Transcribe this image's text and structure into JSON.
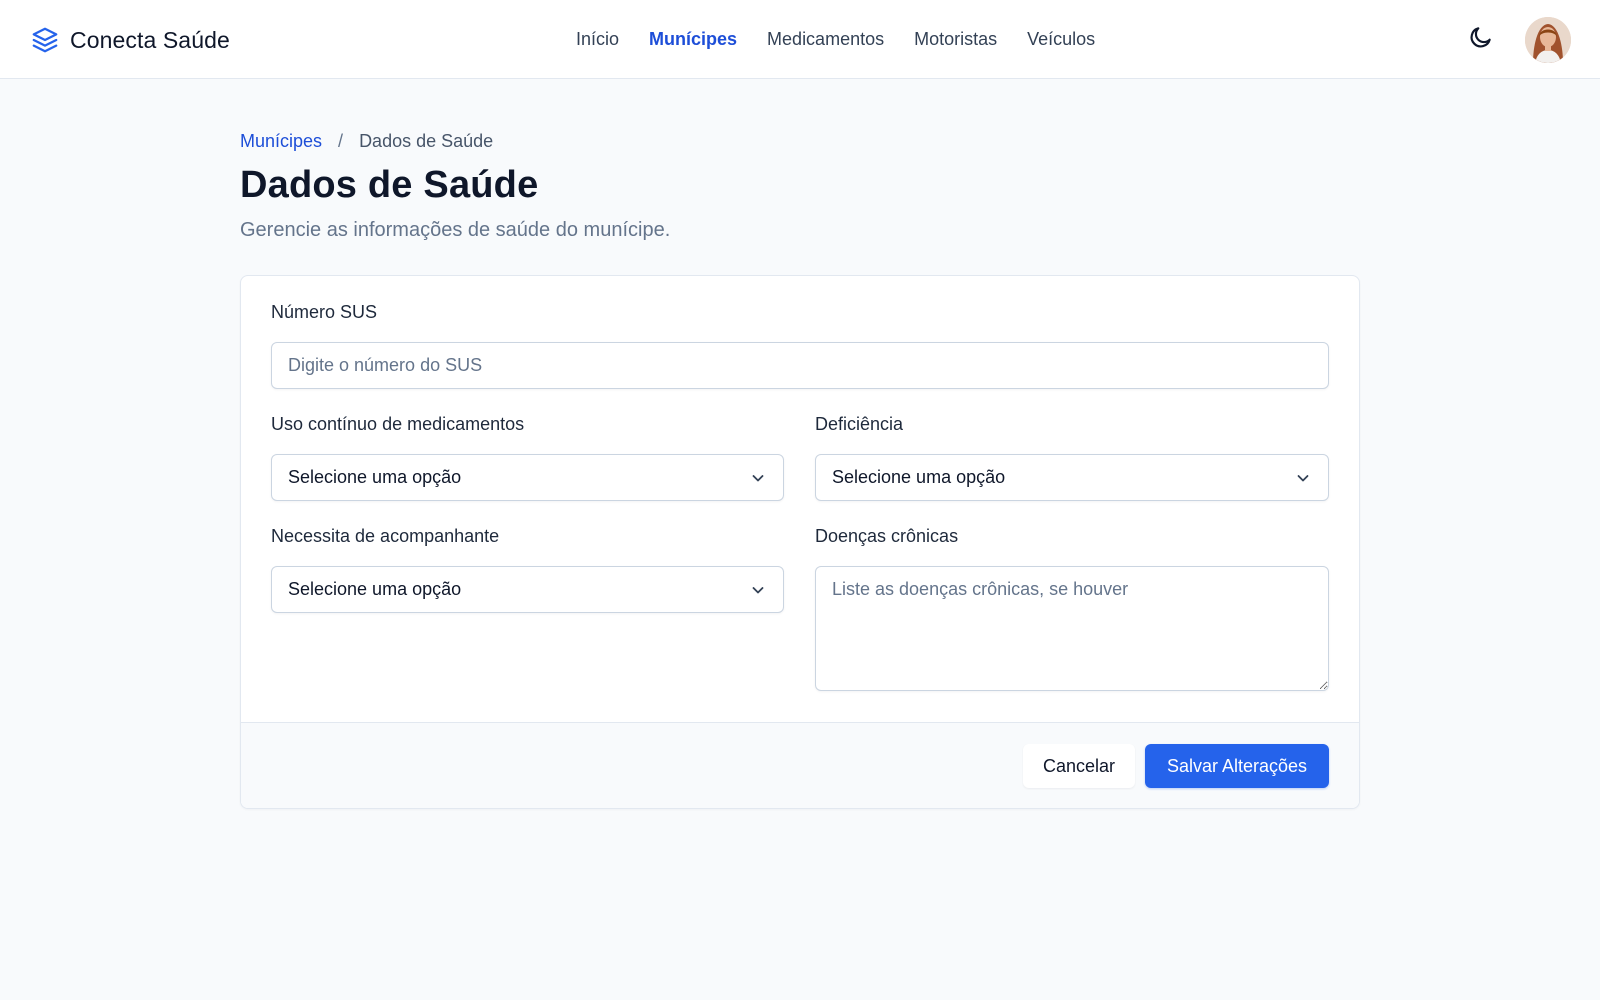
{
  "app": {
    "name": "Conecta Saúde",
    "logo_icon": "layers-icon"
  },
  "nav": {
    "items": [
      {
        "label": "Início",
        "active": false
      },
      {
        "label": "Munícipes",
        "active": true
      },
      {
        "label": "Medicamentos",
        "active": false
      },
      {
        "label": "Motoristas",
        "active": false
      },
      {
        "label": "Veículos",
        "active": false
      }
    ]
  },
  "header": {
    "theme_toggle_icon": "moon-icon",
    "avatar_icon": "user-avatar"
  },
  "breadcrumb": {
    "parent": "Munícipes",
    "separator": "/",
    "current": "Dados de Saúde"
  },
  "page": {
    "title": "Dados de Saúde",
    "subtitle": "Gerencie as informações de saúde do munícipe."
  },
  "form": {
    "sus": {
      "label": "Número SUS",
      "placeholder": "Digite o número do SUS",
      "value": ""
    },
    "continuous_medication": {
      "label": "Uso contínuo de medicamentos",
      "value": "Selecione uma opção"
    },
    "disability": {
      "label": "Deficiência",
      "value": "Selecione uma opção"
    },
    "companion": {
      "label": "Necessita de acompanhante",
      "value": "Selecione uma opção"
    },
    "chronic_diseases": {
      "label": "Doenças crônicas",
      "placeholder": "Liste as doenças crônicas, se houver",
      "value": ""
    }
  },
  "actions": {
    "cancel_label": "Cancelar",
    "save_label": "Salvar Alterações"
  },
  "colors": {
    "accent": "#2563eb",
    "active_nav": "#1d4ed8",
    "background": "#f8fafc"
  }
}
